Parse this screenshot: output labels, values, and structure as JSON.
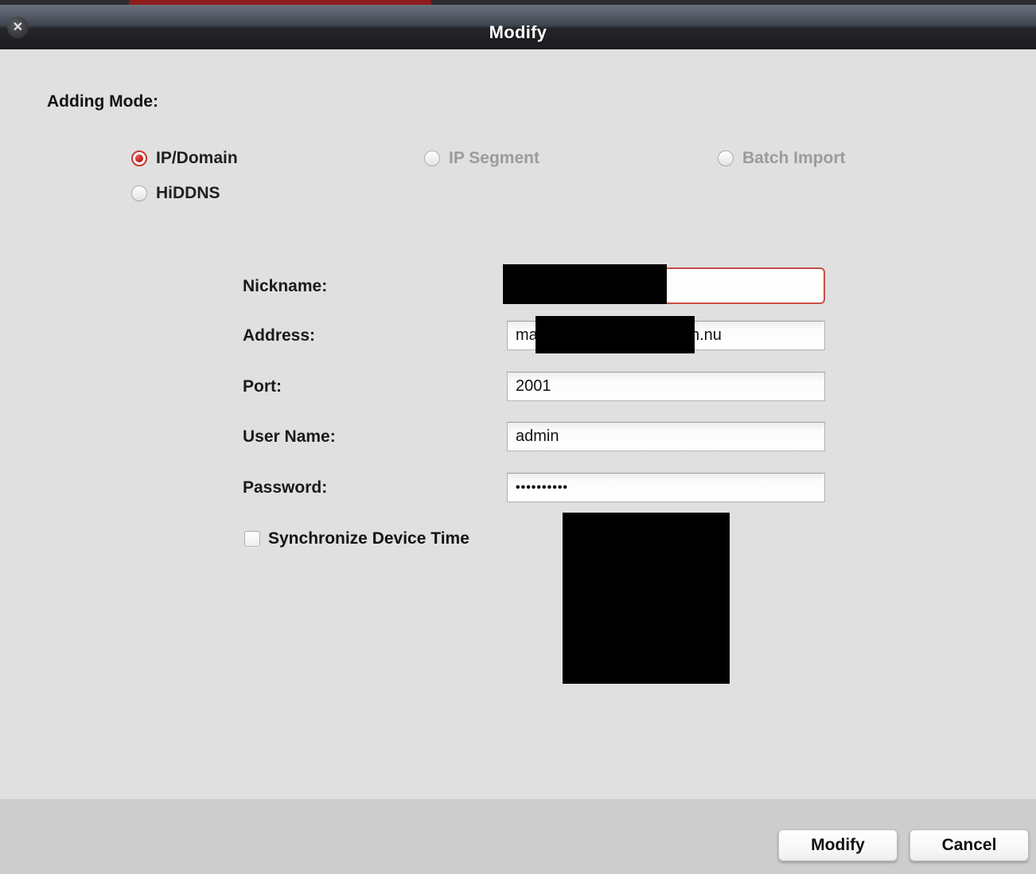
{
  "window": {
    "title": "Modify",
    "close_icon": "✕"
  },
  "adding_mode": {
    "label": "Adding Mode:",
    "options": [
      {
        "label": "IP/Domain",
        "selected": true,
        "enabled": true
      },
      {
        "label": "IP Segment",
        "selected": false,
        "enabled": false
      },
      {
        "label": "Batch Import",
        "selected": false,
        "enabled": false
      },
      {
        "label": "HiDDNS",
        "selected": false,
        "enabled": true
      }
    ]
  },
  "form": {
    "nickname": {
      "label": "Nickname:",
      "value": ""
    },
    "address": {
      "label": "Address:",
      "value_prefix": "ma",
      "value_suffix": "n.nu"
    },
    "port": {
      "label": "Port:",
      "value": "2001"
    },
    "username": {
      "label": "User Name:",
      "value": "admin"
    },
    "password": {
      "label": "Password:",
      "value_masked": "••••••••••"
    },
    "sync_time": {
      "label": "Synchronize Device Time",
      "checked": false
    }
  },
  "footer": {
    "modify_label": "Modify",
    "cancel_label": "Cancel"
  },
  "colors": {
    "accent_red_border": "#c75049",
    "radio_selected_red": "#c01a14",
    "titlebar_dark": "#1b1c1e",
    "body_bg": "#e0e0e0",
    "footer_bg": "#cdcdcd",
    "top_strip_red": "#8e1c1c"
  }
}
